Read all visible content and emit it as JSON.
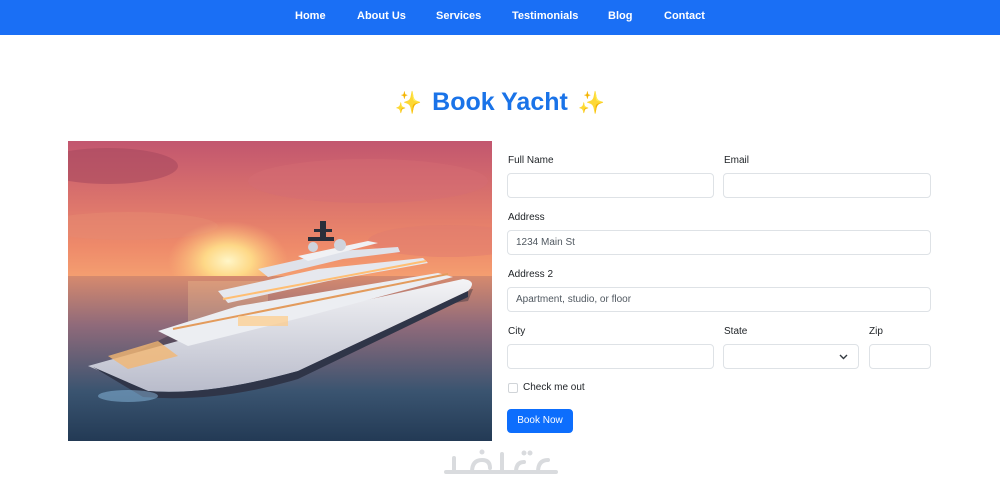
{
  "nav": {
    "items": [
      {
        "label": "Home"
      },
      {
        "label": "About Us"
      },
      {
        "label": "Services"
      },
      {
        "label": "Testimonials"
      },
      {
        "label": "Blog"
      },
      {
        "label": "Contact"
      }
    ],
    "background": "#1a6ff5"
  },
  "page": {
    "title": "Book Yacht",
    "title_color": "#1a73e8",
    "title_icon": "sparkles-icon"
  },
  "hero": {
    "image_subject": "luxury superyacht at sunset",
    "image_icon": "yacht-photo"
  },
  "form": {
    "full_name": {
      "label": "Full Name",
      "value": ""
    },
    "email": {
      "label": "Email",
      "value": ""
    },
    "address": {
      "label": "Address",
      "placeholder": "1234 Main St",
      "value": ""
    },
    "address2": {
      "label": "Address 2",
      "placeholder": "Apartment, studio, or floor",
      "value": ""
    },
    "city": {
      "label": "City",
      "value": ""
    },
    "state": {
      "label": "State",
      "selected": ""
    },
    "zip": {
      "label": "Zip",
      "value": ""
    },
    "check": {
      "label": "Check me out",
      "checked": false
    },
    "submit_label": "Book Now",
    "accent": "#0d6efd"
  },
  "watermark": {
    "text": "خمسات",
    "icon": "khamsat-watermark"
  }
}
